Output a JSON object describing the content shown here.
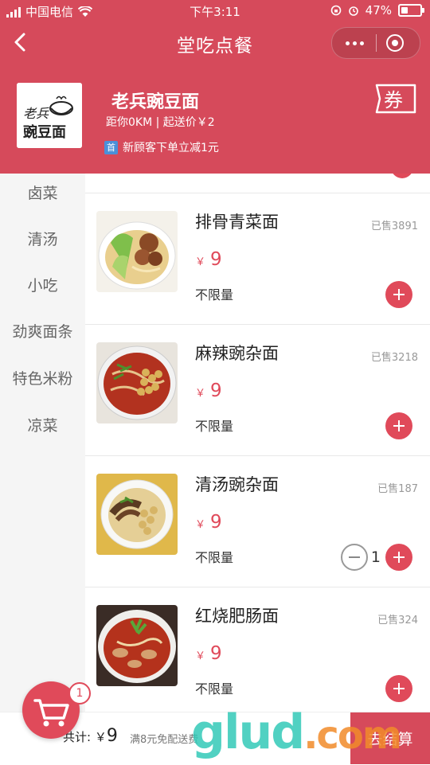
{
  "status_bar": {
    "carrier": "中国电信",
    "time": "下午3:11",
    "battery": "47%"
  },
  "nav": {
    "title": "堂吃点餐"
  },
  "store": {
    "name": "老兵豌豆面",
    "meta": "距你0KM | 起送价￥2",
    "promo_badge": "首",
    "promo_text": "新顾客下单立减1元",
    "logo_text_1": "老兵",
    "logo_text_2": "豌豆面",
    "coupon_label": "券"
  },
  "categories": [
    "卤菜",
    "清汤",
    "小吃",
    "劲爽面条",
    "特色米粉",
    "凉菜"
  ],
  "items": [
    {
      "name": "排骨青菜面",
      "sold": "已售3891",
      "currency": "￥",
      "price": "9",
      "limit": "不限量",
      "qty": ""
    },
    {
      "name": "麻辣豌杂面",
      "sold": "已售3218",
      "currency": "￥",
      "price": "9",
      "limit": "不限量",
      "qty": ""
    },
    {
      "name": "清汤豌杂面",
      "sold": "已售187",
      "currency": "￥",
      "price": "9",
      "limit": "不限量",
      "qty": "1"
    },
    {
      "name": "红烧肥肠面",
      "sold": "已售324",
      "currency": "￥",
      "price": "9",
      "limit": "不限量",
      "qty": ""
    }
  ],
  "cart": {
    "badge": "1",
    "total_label": "共计: ￥",
    "total_value": "9",
    "delivery_note": "满8元免配送费",
    "checkout_label": "去结算"
  },
  "watermark": {
    "text": "glud",
    "suffix": ".com"
  },
  "colors": {
    "brand": "#d64a5b",
    "accent": "#e04a5a"
  }
}
